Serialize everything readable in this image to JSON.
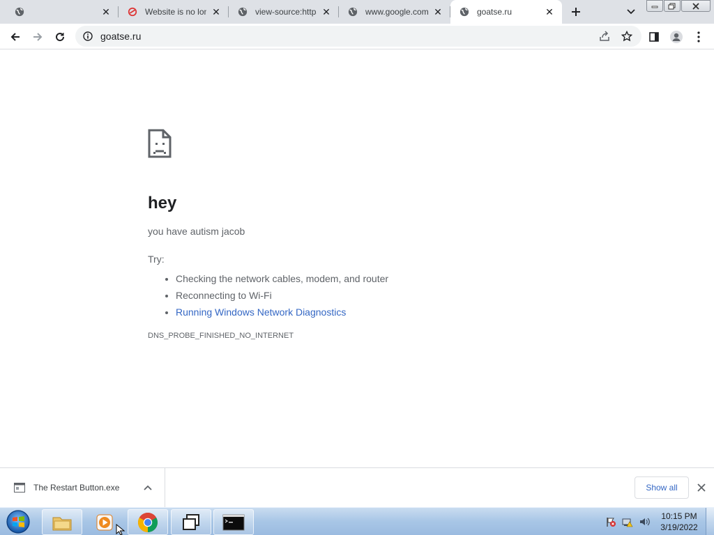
{
  "tabs": [
    {
      "title": "",
      "favicon": "globe-icon",
      "active": false
    },
    {
      "title": "Website is no longer",
      "favicon": "site-logo-icon",
      "active": false
    },
    {
      "title": "view-source:https://",
      "favicon": "globe-icon",
      "active": false
    },
    {
      "title": "www.google.com",
      "favicon": "globe-icon",
      "active": false
    },
    {
      "title": "goatse.ru",
      "favicon": "globe-icon",
      "active": true
    }
  ],
  "toolbar": {
    "url": "goatse.ru"
  },
  "page": {
    "heading": "hey",
    "message": "you have autism jacob",
    "try_label": "Try:",
    "suggestions": [
      "Checking the network cables, modem, and router",
      "Reconnecting to Wi-Fi",
      "Running Windows Network Diagnostics"
    ],
    "error_code": "DNS_PROBE_FINISHED_NO_INTERNET"
  },
  "downloads": {
    "filename": "The Restart Button.exe",
    "show_all_label": "Show all"
  },
  "taskbar": {
    "time": "10:15 PM",
    "date": "3/19/2022",
    "items": [
      "file-explorer-icon",
      "media-player-icon",
      "chrome-icon",
      "window-switcher-icon",
      "command-prompt-icon"
    ]
  },
  "colors": {
    "link": "#3467c4",
    "tabstrip": "#dee1e6",
    "taskbar": "#a8c6e6"
  }
}
